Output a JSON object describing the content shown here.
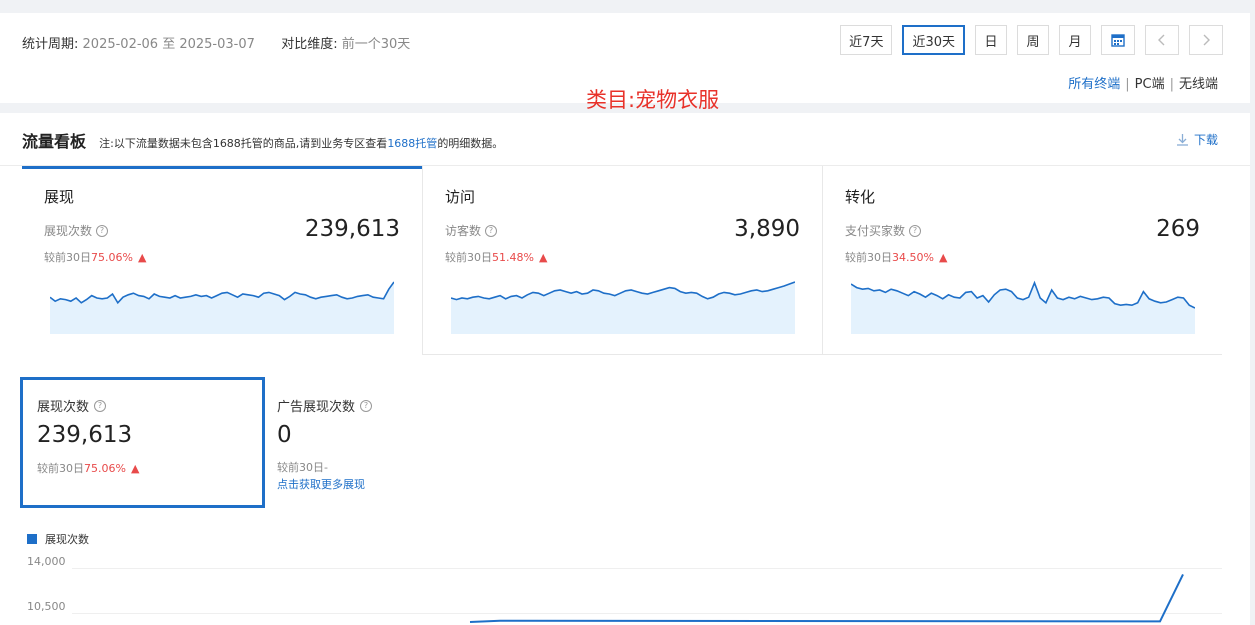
{
  "filter": {
    "period_label": "统计周期:",
    "period_value": "2025-02-06 至 2025-03-07",
    "compare_label": "对比维度:",
    "compare_value": "前一个30天",
    "buttons": [
      "近7天",
      "近30天",
      "日",
      "周",
      "月"
    ],
    "active_button": "近30天",
    "calendar_icon": "calendar-icon",
    "terminals": [
      "所有终端",
      "PC端",
      "无线端"
    ]
  },
  "category_label": "类目:宠物衣服",
  "board": {
    "title": "流量看板",
    "note_prefix": "注:以下流量数据未包含1688托管的商品,请到业务专区查看",
    "note_link": "1688托管",
    "note_suffix": "的明细数据。",
    "download_label": "下载"
  },
  "cards": [
    {
      "title": "展现",
      "metric": "展现次数",
      "value": "239,613",
      "cmp_prefix": "较前30日",
      "cmp_pct": "75.06%",
      "spark": [
        0.62,
        0.52,
        0.58,
        0.56,
        0.52,
        0.6,
        0.48,
        0.56,
        0.66,
        0.6,
        0.58,
        0.6,
        0.7,
        0.48,
        0.62,
        0.68,
        0.72,
        0.66,
        0.64,
        0.58,
        0.7,
        0.64,
        0.62,
        0.6,
        0.66,
        0.6,
        0.62,
        0.64,
        0.68,
        0.64,
        0.66,
        0.6,
        0.66,
        0.72,
        0.74,
        0.68,
        0.62,
        0.7,
        0.68,
        0.66,
        0.62,
        0.72,
        0.74,
        0.7,
        0.66,
        0.56,
        0.64,
        0.74,
        0.7,
        0.68,
        0.62,
        0.58,
        0.62,
        0.64,
        0.66,
        0.68,
        0.62,
        0.58,
        0.6,
        0.64,
        0.66,
        0.68,
        0.62,
        0.6,
        0.58,
        0.82,
        1.0
      ]
    },
    {
      "title": "访问",
      "metric": "访客数",
      "value": "3,890",
      "cmp_prefix": "较前30日",
      "cmp_pct": "51.48%",
      "spark": [
        0.6,
        0.56,
        0.6,
        0.58,
        0.62,
        0.64,
        0.6,
        0.58,
        0.62,
        0.66,
        0.58,
        0.64,
        0.66,
        0.6,
        0.68,
        0.74,
        0.72,
        0.66,
        0.72,
        0.78,
        0.8,
        0.76,
        0.72,
        0.76,
        0.7,
        0.72,
        0.8,
        0.78,
        0.72,
        0.7,
        0.66,
        0.72,
        0.78,
        0.8,
        0.76,
        0.72,
        0.7,
        0.74,
        0.78,
        0.82,
        0.86,
        0.84,
        0.76,
        0.72,
        0.74,
        0.72,
        0.64,
        0.58,
        0.62,
        0.7,
        0.74,
        0.72,
        0.68,
        0.7,
        0.74,
        0.78,
        0.8,
        0.76,
        0.78,
        0.82,
        0.86,
        0.9,
        0.95,
        1.0
      ]
    },
    {
      "title": "转化",
      "metric": "支付买家数",
      "value": "269",
      "cmp_prefix": "较前30日",
      "cmp_pct": "34.50%",
      "spark": [
        0.95,
        0.86,
        0.82,
        0.84,
        0.78,
        0.8,
        0.74,
        0.82,
        0.78,
        0.72,
        0.66,
        0.76,
        0.7,
        0.62,
        0.72,
        0.66,
        0.58,
        0.68,
        0.62,
        0.6,
        0.74,
        0.76,
        0.6,
        0.66,
        0.5,
        0.68,
        0.8,
        0.82,
        0.76,
        0.6,
        0.56,
        0.62,
        0.98,
        0.6,
        0.48,
        0.8,
        0.6,
        0.56,
        0.62,
        0.58,
        0.64,
        0.6,
        0.56,
        0.58,
        0.62,
        0.6,
        0.46,
        0.42,
        0.44,
        0.42,
        0.48,
        0.76,
        0.58,
        0.52,
        0.48,
        0.5,
        0.56,
        0.62,
        0.6,
        0.42,
        0.35
      ]
    }
  ],
  "subcards": [
    {
      "label": "展现次数",
      "value": "239,613",
      "cmp_prefix": "较前30日",
      "cmp_pct": "75.06%"
    },
    {
      "label": "广告展现次数",
      "value": "0",
      "cmp_text": "较前30日-",
      "link": "点击获取更多展现"
    }
  ],
  "chart_data": {
    "type": "line",
    "legend": [
      "展现次数"
    ],
    "yticks": [
      "14,000",
      "10,500"
    ],
    "series": [
      {
        "name": "展现次数",
        "values": [
          9800,
          9900,
          9850,
          13500
        ]
      }
    ],
    "ylim": [
      0,
      14000
    ]
  }
}
